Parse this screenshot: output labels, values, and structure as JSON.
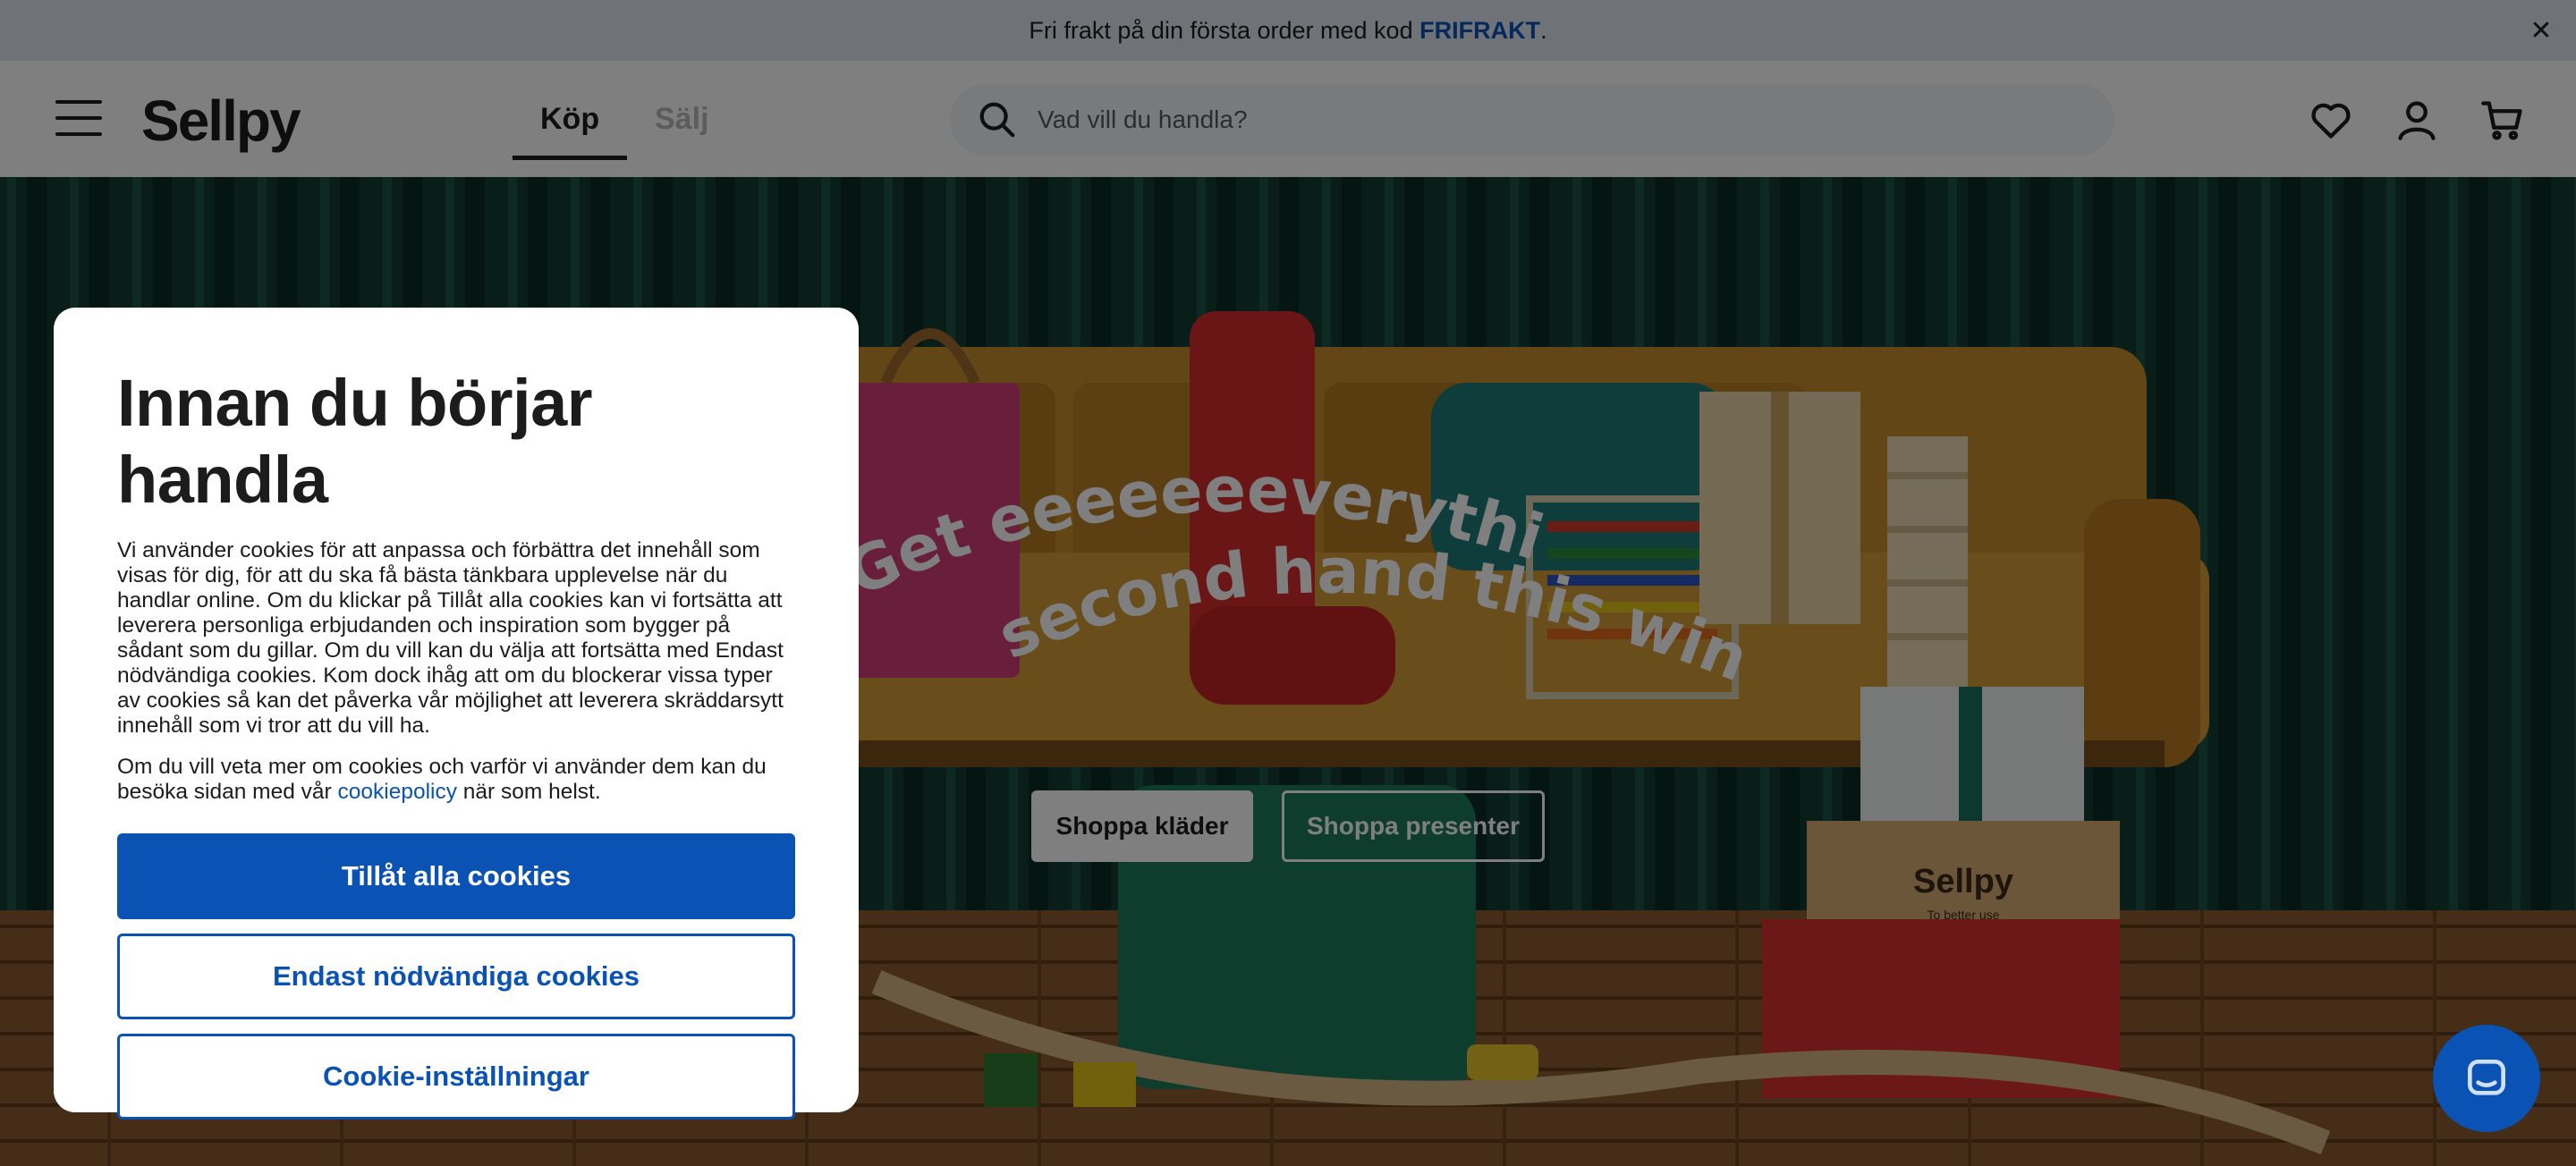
{
  "promo": {
    "text": "Fri frakt på din första order med kod ",
    "code": "FRIFRAKT",
    "suffix": "."
  },
  "header": {
    "logo": "Sellpy",
    "tabs": [
      {
        "label": "Köp",
        "active": true
      },
      {
        "label": "Sälj",
        "active": false
      }
    ],
    "search_placeholder": "Vad vill du handla?"
  },
  "hero": {
    "headline_line1": "Get eeeeeeeverything",
    "headline_line2": "second hand this winter",
    "button_primary": "Shoppa kläder",
    "button_secondary": "Shoppa presenter",
    "box_brand": "Sellpy",
    "box_tagline": "To better use"
  },
  "cookie_modal": {
    "title": "Innan du börjar handla",
    "body": "Vi använder cookies för att anpassa och förbättra det innehåll som visas för dig, för att du ska få bästa tänkbara upplevelse när du handlar online. Om du klickar på Tillåt alla cookies kan vi fortsätta att leverera personliga erbjudanden och inspiration som bygger på sådant som du gillar. Om du vill kan du välja att fortsätta med Endast nödvändiga cookies. Kom dock ihåg att om du blockerar vissa typer av cookies så kan det påverka vår möjlighet att leverera skräddarsytt innehåll som vi tror att du vill ha.",
    "more_text": "Om du vill veta mer om cookies och varför vi använder dem kan du besöka sidan med vår ",
    "policy_link": "cookiepolicy",
    "more_suffix": " när som helst.",
    "allow_all": "Tillåt alla cookies",
    "necessary_only": "Endast nödvändiga cookies",
    "settings": "Cookie-inställningar"
  },
  "icons": [
    "close-icon",
    "menu-icon",
    "search-icon",
    "heart-icon",
    "user-icon",
    "cart-icon",
    "chat-icon"
  ],
  "colors": {
    "accent": "#0b52b5",
    "promo_bg": "#dfe5ee",
    "overlay": "rgba(0,0,0,0.5)"
  }
}
